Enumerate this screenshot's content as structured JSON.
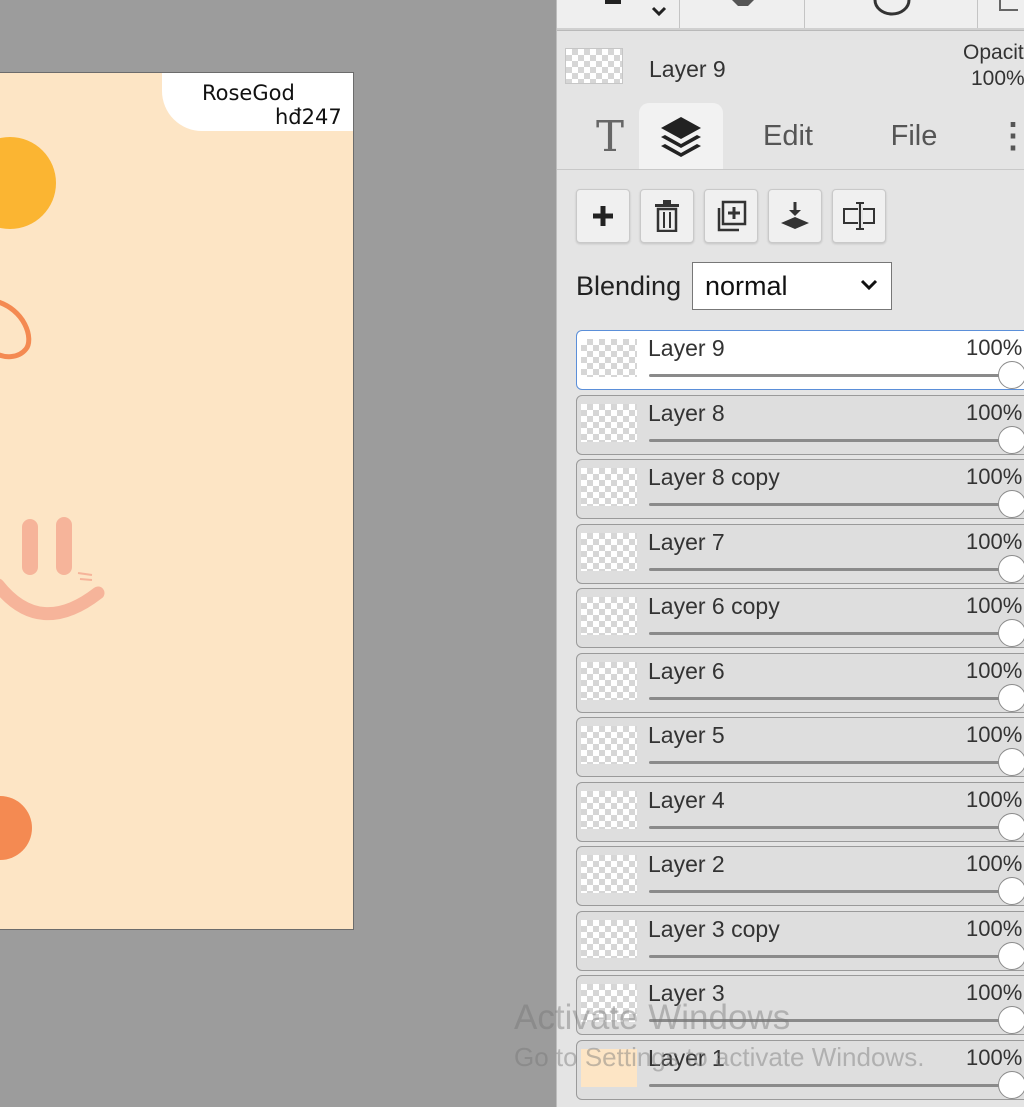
{
  "canvas": {
    "watermark_line1": "RoseGod",
    "watermark_line2": "hđ247",
    "background_color": "#fde5c5",
    "accent_colors": [
      "#fbb532",
      "#f48a52",
      "#f6b49a"
    ]
  },
  "panel": {
    "current_layer": {
      "name": "Layer 9",
      "opacity_label": "Opacit",
      "opacity_value": "100%"
    },
    "tabs": [
      {
        "label": "T",
        "icon": "text-tool-icon"
      },
      {
        "label": "",
        "icon": "layers-icon"
      },
      {
        "label": "Edit"
      },
      {
        "label": "File"
      },
      {
        "label": "⋮",
        "icon": "more-vertical-icon"
      }
    ],
    "layer_buttons": [
      {
        "icon": "plus-icon"
      },
      {
        "icon": "trash-icon"
      },
      {
        "icon": "duplicate-icon"
      },
      {
        "icon": "merge-down-icon"
      },
      {
        "icon": "rename-icon"
      }
    ],
    "blending": {
      "label": "Blending",
      "value": "normal"
    },
    "layers": [
      {
        "name": "Layer 9",
        "opacity": "100%",
        "active": true
      },
      {
        "name": "Layer 8",
        "opacity": "100%"
      },
      {
        "name": "Layer 8 copy",
        "opacity": "100%"
      },
      {
        "name": "Layer 7",
        "opacity": "100%"
      },
      {
        "name": "Layer 6 copy",
        "opacity": "100%"
      },
      {
        "name": "Layer 6",
        "opacity": "100%"
      },
      {
        "name": "Layer 5",
        "opacity": "100%"
      },
      {
        "name": "Layer 4",
        "opacity": "100%"
      },
      {
        "name": "Layer 2",
        "opacity": "100%"
      },
      {
        "name": "Layer 3 copy",
        "opacity": "100%"
      },
      {
        "name": "Layer 3",
        "opacity": "100%"
      },
      {
        "name": "Layer 1",
        "opacity": "100%"
      }
    ]
  },
  "os_overlay": {
    "title": "Activate Windows",
    "subtitle": "Go to Settings to activate Windows."
  }
}
